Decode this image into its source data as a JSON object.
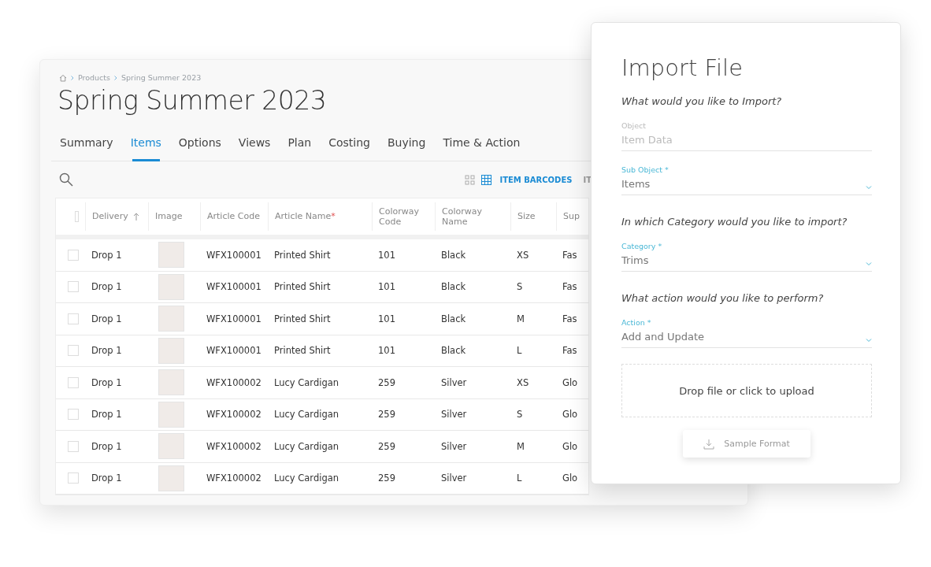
{
  "breadcrumb": [
    "Products",
    "Spring Summer 2023"
  ],
  "title": "Spring Summer 2023",
  "tabs": [
    {
      "label": "Summary",
      "selected": false
    },
    {
      "label": "Items",
      "selected": true
    },
    {
      "label": "Options",
      "selected": false
    },
    {
      "label": "Views",
      "selected": false
    },
    {
      "label": "Plan",
      "selected": false
    },
    {
      "label": "Costing",
      "selected": false
    },
    {
      "label": "Buying",
      "selected": false
    },
    {
      "label": "Time & Action",
      "selected": false
    }
  ],
  "toolbar": {
    "views": [
      {
        "kind": "tiles",
        "selected": false
      },
      {
        "kind": "grid",
        "selected": true
      }
    ],
    "actions": [
      "ITEM BARCODES",
      "IT"
    ]
  },
  "table": {
    "select_all_checked": false,
    "columns": [
      {
        "label": "Delivery",
        "sorted": true
      },
      {
        "label": "Image",
        "sorted": false
      },
      {
        "label": "Article Code",
        "sorted": false
      },
      {
        "label": "Article Name",
        "sorted": false,
        "required_mark": "*"
      },
      {
        "label": "Colorway Code",
        "sorted": false
      },
      {
        "label": "Colorway Name",
        "sorted": false
      },
      {
        "label": "Size",
        "sorted": false
      },
      {
        "label": "Sup"
      }
    ],
    "rows": [
      {
        "checked": false,
        "cells": [
          "Drop 1",
          "",
          "WFX100001",
          "Printed Shirt",
          "101",
          "Black",
          "XS",
          "Fas"
        ]
      },
      {
        "checked": false,
        "cells": [
          "Drop 1",
          "",
          "WFX100001",
          "Printed Shirt",
          "101",
          "Black",
          "S",
          "Fas"
        ]
      },
      {
        "checked": false,
        "cells": [
          "Drop 1",
          "",
          "WFX100001",
          "Printed Shirt",
          "101",
          "Black",
          "M",
          "Fas"
        ]
      },
      {
        "checked": false,
        "cells": [
          "Drop 1",
          "",
          "WFX100001",
          "Printed Shirt",
          "101",
          "Black",
          "L",
          "Fas"
        ]
      },
      {
        "checked": false,
        "cells": [
          "Drop 1",
          "",
          "WFX100002",
          "Lucy Cardigan",
          "259",
          "Silver",
          "XS",
          "Glo"
        ]
      },
      {
        "checked": false,
        "cells": [
          "Drop 1",
          "",
          "WFX100002",
          "Lucy Cardigan",
          "259",
          "Silver",
          "S",
          "Glo"
        ]
      },
      {
        "checked": false,
        "cells": [
          "Drop 1",
          "",
          "WFX100002",
          "Lucy Cardigan",
          "259",
          "Silver",
          "M",
          "Glo"
        ]
      },
      {
        "checked": false,
        "cells": [
          "Drop 1",
          "",
          "WFX100002",
          "Lucy Cardigan",
          "259",
          "Silver",
          "L",
          "Glo"
        ]
      }
    ]
  },
  "dialog": {
    "title": "Import File",
    "sections": [
      {
        "question": "What would you like to Import?",
        "field": {
          "label": "Object",
          "value": "Item Data",
          "disabled": true,
          "dropdown": false
        }
      },
      {
        "field": {
          "label": "Sub Object *",
          "value": "Items",
          "disabled": false,
          "dropdown": true
        }
      },
      {
        "question": "In which Category would you like to import?",
        "field": {
          "label": "Category *",
          "value": "Trims",
          "disabled": false,
          "dropdown": true
        }
      },
      {
        "question": "What action would you like to perform?",
        "field": {
          "label": "Action *",
          "value": "Add and Update",
          "disabled": false,
          "dropdown": true
        }
      }
    ],
    "upload": "Drop file or click to upload",
    "sample_button": "Sample Format"
  }
}
